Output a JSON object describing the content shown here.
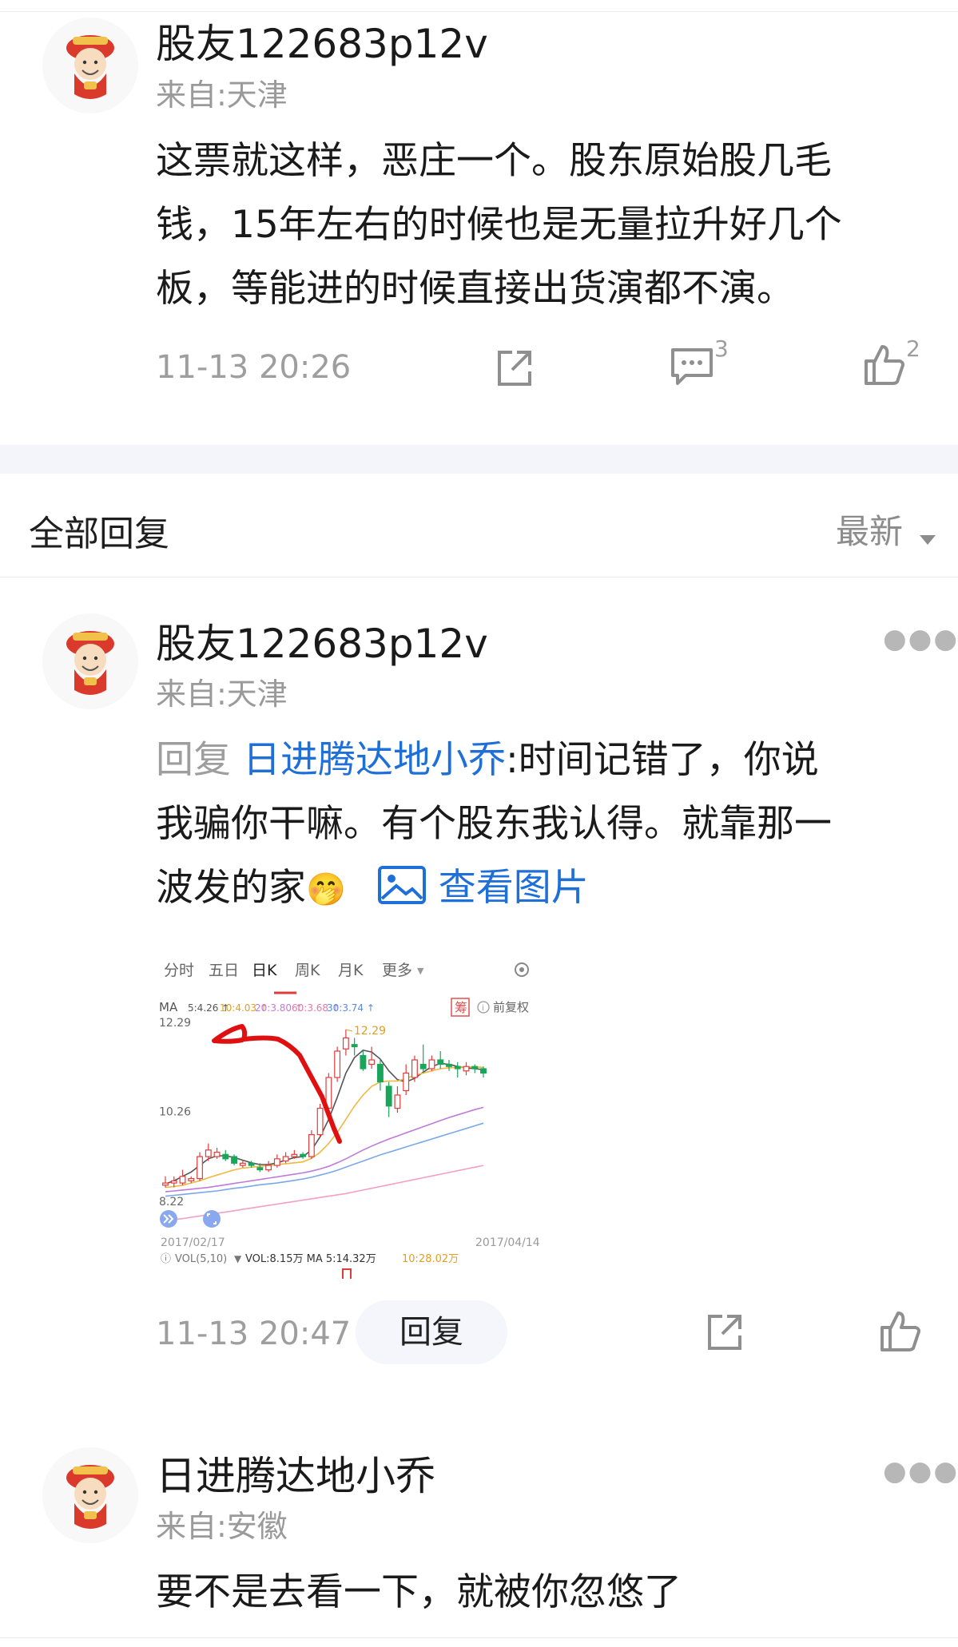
{
  "post": {
    "author": "股友122683p12v",
    "source": "来自:天津",
    "lines": [
      "这票就这样，恶庄一个。股东原始股几毛",
      "钱，15年左右的时候也是无量拉升好几个",
      "板，等能进的时候直接出货演都不演。"
    ],
    "time": "11-13 20:26",
    "comment_count": "3",
    "like_count": "2",
    "icons": {
      "share": "share-icon",
      "comment": "comment-icon",
      "like": "thumb-up-icon"
    }
  },
  "replies_header": {
    "title": "全部回复",
    "sort": "最新"
  },
  "reply1": {
    "author": "股友122683p12v",
    "source": "来自:天津",
    "prefix": "回复",
    "mention": "日进腾达地小乔",
    "line1_rest": ":时间记错了，你说",
    "line2": "我骗你干嘛。有个股东我认得。就靠那一",
    "line3": "波发的家",
    "emoji": "🤭",
    "view_image": "查看图片",
    "time": "11-13 20:47",
    "reply_button": "回复"
  },
  "chart_data": {
    "type": "candlestick",
    "tabs": [
      "分时",
      "五日",
      "日K",
      "周K",
      "月K",
      "更多"
    ],
    "active_tab": "日K",
    "ma_labels": [
      "MA",
      "5:4.26",
      "10:4.03",
      "20:3.80",
      "60:3.68",
      "30:3.74"
    ],
    "badge": "筹",
    "restore_label": "前复权",
    "y_ticks": [
      "12.29",
      "10.26",
      "8.22"
    ],
    "peak_label": "12.29",
    "x_labels": [
      "2017/02/17",
      "2017/04/14"
    ],
    "vol_label": "VOL(5,10)",
    "vol_values": "VOL:8.15万 MA 5:14.32万",
    "vol_ma10": "10:28.02万",
    "ylim": [
      8.22,
      12.29
    ],
    "candles": [
      {
        "o": 8.75,
        "c": 8.8,
        "h": 8.95,
        "l": 8.7
      },
      {
        "o": 8.8,
        "c": 8.85,
        "h": 8.95,
        "l": 8.7
      },
      {
        "o": 8.8,
        "c": 8.95,
        "h": 9.1,
        "l": 8.75
      },
      {
        "o": 8.85,
        "c": 8.9,
        "h": 8.95,
        "l": 8.8
      },
      {
        "o": 8.9,
        "c": 9.4,
        "h": 9.5,
        "l": 8.85
      },
      {
        "o": 9.4,
        "c": 9.55,
        "h": 9.7,
        "l": 9.3
      },
      {
        "o": 9.4,
        "c": 9.5,
        "h": 9.6,
        "l": 9.35
      },
      {
        "o": 9.45,
        "c": 9.35,
        "h": 9.55,
        "l": 9.3
      },
      {
        "o": 9.4,
        "c": 9.25,
        "h": 9.45,
        "l": 9.2
      },
      {
        "o": 9.2,
        "c": 9.25,
        "h": 9.3,
        "l": 9.15
      },
      {
        "o": 9.25,
        "c": 9.2,
        "h": 9.3,
        "l": 9.15
      },
      {
        "o": 9.15,
        "c": 9.1,
        "h": 9.25,
        "l": 9.05
      },
      {
        "o": 9.1,
        "c": 9.2,
        "h": 9.3,
        "l": 9.05
      },
      {
        "o": 9.2,
        "c": 9.35,
        "h": 9.45,
        "l": 9.15
      },
      {
        "o": 9.3,
        "c": 9.4,
        "h": 9.5,
        "l": 9.25
      },
      {
        "o": 9.4,
        "c": 9.45,
        "h": 9.55,
        "l": 9.35
      },
      {
        "o": 9.45,
        "c": 9.4,
        "h": 9.5,
        "l": 9.35
      },
      {
        "o": 9.4,
        "c": 9.9,
        "h": 10.0,
        "l": 9.35
      },
      {
        "o": 9.9,
        "c": 10.5,
        "h": 10.6,
        "l": 9.85
      },
      {
        "o": 10.5,
        "c": 11.2,
        "h": 11.3,
        "l": 10.4
      },
      {
        "o": 11.2,
        "c": 11.8,
        "h": 11.9,
        "l": 11.1
      },
      {
        "o": 11.85,
        "c": 12.1,
        "h": 12.29,
        "l": 11.7
      },
      {
        "o": 11.95,
        "c": 11.9,
        "h": 12.1,
        "l": 11.7
      },
      {
        "o": 11.7,
        "c": 11.4,
        "h": 11.8,
        "l": 11.35
      },
      {
        "o": 11.5,
        "c": 11.6,
        "h": 11.9,
        "l": 11.4
      },
      {
        "o": 11.5,
        "c": 11.1,
        "h": 11.6,
        "l": 10.9
      },
      {
        "o": 11.0,
        "c": 10.55,
        "h": 11.1,
        "l": 10.3
      },
      {
        "o": 10.5,
        "c": 10.8,
        "h": 11.0,
        "l": 10.4
      },
      {
        "o": 10.9,
        "c": 11.3,
        "h": 11.5,
        "l": 10.8
      },
      {
        "o": 11.2,
        "c": 11.6,
        "h": 11.7,
        "l": 11.1
      },
      {
        "o": 11.5,
        "c": 11.4,
        "h": 11.95,
        "l": 11.3
      },
      {
        "o": 11.4,
        "c": 11.6,
        "h": 11.7,
        "l": 11.35
      },
      {
        "o": 11.6,
        "c": 11.5,
        "h": 11.8,
        "l": 11.4
      },
      {
        "o": 11.5,
        "c": 11.45,
        "h": 11.6,
        "l": 11.35
      },
      {
        "o": 11.45,
        "c": 11.4,
        "h": 11.55,
        "l": 11.2
      },
      {
        "o": 11.35,
        "c": 11.45,
        "h": 11.55,
        "l": 11.25
      },
      {
        "o": 11.45,
        "c": 11.4,
        "h": 11.5,
        "l": 11.3
      },
      {
        "o": 11.4,
        "c": 11.3,
        "h": 11.45,
        "l": 11.2
      }
    ],
    "ma_lines": [
      {
        "color": "#555555",
        "values": [
          8.78,
          8.85,
          8.95,
          9.05,
          9.2,
          9.35,
          9.42,
          9.42,
          9.38,
          9.32,
          9.26,
          9.22,
          9.22,
          9.26,
          9.32,
          9.38,
          9.4,
          9.55,
          9.85,
          10.25,
          10.75,
          11.3,
          11.65,
          11.82,
          11.78,
          11.62,
          11.35,
          11.15,
          11.1,
          11.18,
          11.32,
          11.45,
          11.52,
          11.5,
          11.45,
          11.42,
          11.4,
          11.38
        ]
      },
      {
        "color": "#f0b840",
        "values": [
          8.7,
          8.72,
          8.75,
          8.8,
          8.85,
          8.92,
          8.98,
          9.04,
          9.1,
          9.14,
          9.16,
          9.18,
          9.2,
          9.22,
          9.24,
          9.26,
          9.28,
          9.36,
          9.5,
          9.7,
          9.95,
          10.25,
          10.55,
          10.8,
          11.0,
          11.1,
          11.12,
          11.12,
          11.18,
          11.25,
          11.3,
          11.35,
          11.4,
          11.42,
          11.43,
          11.44,
          11.44,
          11.43
        ]
      },
      {
        "color": "#c07ad8",
        "values": [
          8.6,
          8.62,
          8.64,
          8.66,
          8.68,
          8.7,
          8.73,
          8.76,
          8.79,
          8.82,
          8.85,
          8.88,
          8.91,
          8.94,
          8.97,
          9.0,
          9.03,
          9.07,
          9.12,
          9.18,
          9.26,
          9.35,
          9.45,
          9.55,
          9.64,
          9.72,
          9.8,
          9.87,
          9.94,
          10.01,
          10.08,
          10.15,
          10.22,
          10.29,
          10.35,
          10.41,
          10.47,
          10.52
        ]
      },
      {
        "color": "#7aa8e8",
        "values": [
          8.5,
          8.52,
          8.54,
          8.56,
          8.58,
          8.6,
          8.62,
          8.65,
          8.68,
          8.7,
          8.73,
          8.76,
          8.78,
          8.8,
          8.83,
          8.86,
          8.89,
          8.93,
          8.98,
          9.03,
          9.09,
          9.16,
          9.23,
          9.3,
          9.37,
          9.44,
          9.5,
          9.56,
          9.62,
          9.68,
          9.74,
          9.8,
          9.86,
          9.92,
          9.98,
          10.04,
          10.1,
          10.16
        ]
      },
      {
        "color": "#f4a0c0",
        "values": [
          7.95,
          7.97,
          7.99,
          8.02,
          8.05,
          8.08,
          8.11,
          8.14,
          8.17,
          8.2,
          8.23,
          8.26,
          8.29,
          8.32,
          8.35,
          8.38,
          8.41,
          8.44,
          8.47,
          8.5,
          8.53,
          8.56,
          8.6,
          8.64,
          8.68,
          8.72,
          8.76,
          8.8,
          8.84,
          8.88,
          8.92,
          8.96,
          9.0,
          9.04,
          9.08,
          9.12,
          9.16,
          9.2
        ]
      }
    ]
  },
  "reply2": {
    "author": "日进腾达地小乔",
    "source": "来自:安徽",
    "text": "要不是去看一下，就被你忽悠了"
  }
}
